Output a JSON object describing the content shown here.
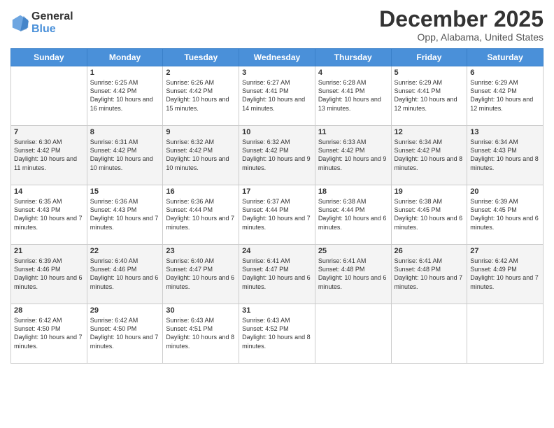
{
  "header": {
    "logo_general": "General",
    "logo_blue": "Blue",
    "title": "December 2025",
    "subtitle": "Opp, Alabama, United States"
  },
  "days": [
    "Sunday",
    "Monday",
    "Tuesday",
    "Wednesday",
    "Thursday",
    "Friday",
    "Saturday"
  ],
  "weeks": [
    [
      {
        "date": "",
        "text": ""
      },
      {
        "date": "1",
        "text": "Sunrise: 6:25 AM\nSunset: 4:42 PM\nDaylight: 10 hours and 16 minutes."
      },
      {
        "date": "2",
        "text": "Sunrise: 6:26 AM\nSunset: 4:42 PM\nDaylight: 10 hours and 15 minutes."
      },
      {
        "date": "3",
        "text": "Sunrise: 6:27 AM\nSunset: 4:41 PM\nDaylight: 10 hours and 14 minutes."
      },
      {
        "date": "4",
        "text": "Sunrise: 6:28 AM\nSunset: 4:41 PM\nDaylight: 10 hours and 13 minutes."
      },
      {
        "date": "5",
        "text": "Sunrise: 6:29 AM\nSunset: 4:41 PM\nDaylight: 10 hours and 12 minutes."
      },
      {
        "date": "6",
        "text": "Sunrise: 6:29 AM\nSunset: 4:42 PM\nDaylight: 10 hours and 12 minutes."
      }
    ],
    [
      {
        "date": "7",
        "text": "Sunrise: 6:30 AM\nSunset: 4:42 PM\nDaylight: 10 hours and 11 minutes."
      },
      {
        "date": "8",
        "text": "Sunrise: 6:31 AM\nSunset: 4:42 PM\nDaylight: 10 hours and 10 minutes."
      },
      {
        "date": "9",
        "text": "Sunrise: 6:32 AM\nSunset: 4:42 PM\nDaylight: 10 hours and 10 minutes."
      },
      {
        "date": "10",
        "text": "Sunrise: 6:32 AM\nSunset: 4:42 PM\nDaylight: 10 hours and 9 minutes."
      },
      {
        "date": "11",
        "text": "Sunrise: 6:33 AM\nSunset: 4:42 PM\nDaylight: 10 hours and 9 minutes."
      },
      {
        "date": "12",
        "text": "Sunrise: 6:34 AM\nSunset: 4:42 PM\nDaylight: 10 hours and 8 minutes."
      },
      {
        "date": "13",
        "text": "Sunrise: 6:34 AM\nSunset: 4:43 PM\nDaylight: 10 hours and 8 minutes."
      }
    ],
    [
      {
        "date": "14",
        "text": "Sunrise: 6:35 AM\nSunset: 4:43 PM\nDaylight: 10 hours and 7 minutes."
      },
      {
        "date": "15",
        "text": "Sunrise: 6:36 AM\nSunset: 4:43 PM\nDaylight: 10 hours and 7 minutes."
      },
      {
        "date": "16",
        "text": "Sunrise: 6:36 AM\nSunset: 4:44 PM\nDaylight: 10 hours and 7 minutes."
      },
      {
        "date": "17",
        "text": "Sunrise: 6:37 AM\nSunset: 4:44 PM\nDaylight: 10 hours and 7 minutes."
      },
      {
        "date": "18",
        "text": "Sunrise: 6:38 AM\nSunset: 4:44 PM\nDaylight: 10 hours and 6 minutes."
      },
      {
        "date": "19",
        "text": "Sunrise: 6:38 AM\nSunset: 4:45 PM\nDaylight: 10 hours and 6 minutes."
      },
      {
        "date": "20",
        "text": "Sunrise: 6:39 AM\nSunset: 4:45 PM\nDaylight: 10 hours and 6 minutes."
      }
    ],
    [
      {
        "date": "21",
        "text": "Sunrise: 6:39 AM\nSunset: 4:46 PM\nDaylight: 10 hours and 6 minutes."
      },
      {
        "date": "22",
        "text": "Sunrise: 6:40 AM\nSunset: 4:46 PM\nDaylight: 10 hours and 6 minutes."
      },
      {
        "date": "23",
        "text": "Sunrise: 6:40 AM\nSunset: 4:47 PM\nDaylight: 10 hours and 6 minutes."
      },
      {
        "date": "24",
        "text": "Sunrise: 6:41 AM\nSunset: 4:47 PM\nDaylight: 10 hours and 6 minutes."
      },
      {
        "date": "25",
        "text": "Sunrise: 6:41 AM\nSunset: 4:48 PM\nDaylight: 10 hours and 6 minutes."
      },
      {
        "date": "26",
        "text": "Sunrise: 6:41 AM\nSunset: 4:48 PM\nDaylight: 10 hours and 7 minutes."
      },
      {
        "date": "27",
        "text": "Sunrise: 6:42 AM\nSunset: 4:49 PM\nDaylight: 10 hours and 7 minutes."
      }
    ],
    [
      {
        "date": "28",
        "text": "Sunrise: 6:42 AM\nSunset: 4:50 PM\nDaylight: 10 hours and 7 minutes."
      },
      {
        "date": "29",
        "text": "Sunrise: 6:42 AM\nSunset: 4:50 PM\nDaylight: 10 hours and 7 minutes."
      },
      {
        "date": "30",
        "text": "Sunrise: 6:43 AM\nSunset: 4:51 PM\nDaylight: 10 hours and 8 minutes."
      },
      {
        "date": "31",
        "text": "Sunrise: 6:43 AM\nSunset: 4:52 PM\nDaylight: 10 hours and 8 minutes."
      },
      {
        "date": "",
        "text": ""
      },
      {
        "date": "",
        "text": ""
      },
      {
        "date": "",
        "text": ""
      }
    ]
  ]
}
